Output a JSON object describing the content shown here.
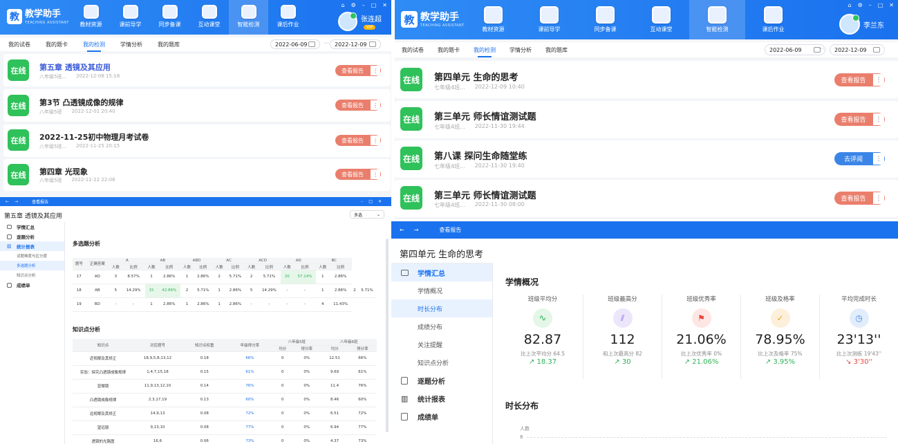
{
  "app": {
    "logo_char": "教",
    "title": "教学助手",
    "subtitle": "TEACHING ASSISTANT"
  },
  "nav": [
    {
      "label": "教材资源"
    },
    {
      "label": "课前导学"
    },
    {
      "label": "同步备课"
    },
    {
      "label": "互动课堂"
    },
    {
      "label": "智能检测"
    },
    {
      "label": "课后作业"
    }
  ],
  "tabs": [
    "我的试卷",
    "我的题卡",
    "我的检测",
    "学情分析",
    "我的题库"
  ],
  "p1": {
    "user": "张连超",
    "vip": "VIP",
    " start_date": "2022-06-09",
    "start": "2022-06-09",
    "end": "2022-12-09",
    "sep": "···",
    "cards": [
      {
        "badge": "在线",
        "title": "第五章 透镜及其应用",
        "cls": "八年级5班...",
        "date": "2022-12-08 15:18",
        "btn": "查看报告"
      },
      {
        "badge": "在线",
        "title": "第3节 凸透镜成像的规律",
        "cls": "八年级5班",
        "date": "2022-12-01 20:40",
        "btn": "查看报告"
      },
      {
        "badge": "在线",
        "title": "2022-11-25初中物理月考试卷",
        "cls": "八年级5班...",
        "date": "2022-11-25 20:15",
        "btn": "查看报告"
      },
      {
        "badge": "在线",
        "title": "第四章 光现象",
        "cls": "八年级5班",
        "date": "2022-11-22 22:08",
        "btn": "查看报告"
      }
    ]
  },
  "p2": {
    "user": "李兰东",
    "start": "2022-06-09",
    "end": "2022-12-09",
    "sep": "···",
    "cards": [
      {
        "badge": "在线",
        "title": "第四单元 生命的思考",
        "cls": "七年级4班...",
        "date": "2022-12-09 10:40",
        "btn": "查看报告"
      },
      {
        "badge": "在线",
        "title": "第三单元 师长情谊测试题",
        "cls": "七年级4班...",
        "date": "2022-11-30 19:44",
        "btn": "查看报告"
      },
      {
        "badge": "在线",
        "title": "第八课 探问生命随堂练",
        "cls": "七年级4班...",
        "date": "2022-11-30 19:40",
        "btn": "去评阅"
      },
      {
        "badge": "在线",
        "title": "第三单元 师长情谊测试题",
        "cls": "七年级4班...",
        "date": "2022-11-30 08:00",
        "btn": "查看报告"
      }
    ]
  },
  "p3": {
    "wtitle": "查看报告",
    "title": "第五章 透镜及其应用",
    "select": "多选",
    "side": [
      {
        "label": "学情汇总",
        "bold": true
      },
      {
        "label": "逐题分析",
        "bold": true
      },
      {
        "label": "统计报表",
        "bold": true,
        "act": true
      },
      {
        "label": "试题难度与区分度"
      },
      {
        "label": "多选题分析",
        "act2": true
      },
      {
        "label": "知识点分析"
      },
      {
        "label": "成绩单",
        "bold": true
      }
    ],
    "sec1": "多选题分析",
    "sec2": "知识点分析",
    "mc_groups": [
      "A",
      "AB",
      "ABD",
      "AC",
      "ACD",
      "AD",
      "BC"
    ],
    "mc_sub": [
      "人数",
      "比例"
    ],
    "mc_head": [
      "题号",
      "正确答案"
    ],
    "mc_rows": [
      [
        "17",
        "AD",
        "3",
        "8.57%",
        "1",
        "2.86%",
        "1",
        "2.86%",
        "2",
        "5.71%",
        "2",
        "5.71%",
        "20",
        "57.14%",
        "1",
        "2.86%"
      ],
      [
        "18",
        "AB",
        "5",
        "14.29%",
        "15",
        "42.86%",
        "2",
        "5.71%",
        "1",
        "2.86%",
        "5",
        "14.29%",
        "-",
        "-",
        "1",
        "2.86%",
        "2",
        "5.71%"
      ],
      [
        "19",
        "BD",
        "-",
        "-",
        "1",
        "2.86%",
        "1",
        "2.86%",
        "1",
        "2.86%",
        "-",
        "-",
        "-",
        "-",
        "4",
        "11.43%"
      ]
    ],
    "kp_head": [
      "知识点",
      "对应题号",
      "知识点权重",
      "年级得分率",
      "八年级5班",
      "八年级6班"
    ],
    "kp_sub": [
      "均分",
      "得分率",
      "均分",
      "得分率"
    ],
    "kp_rows": [
      [
        "近视眼及其矫正",
        "18,9,5,8,13,12",
        "0.18",
        "66%",
        "0",
        "0%",
        "12.51",
        "66%"
      ],
      [
        "实验：探究凸透镜成像规律",
        "1,4,7,15,18",
        "0.15",
        "61%",
        "0",
        "0%",
        "9.69",
        "61%"
      ],
      [
        "显微镜",
        "11,9,13,12,10",
        "0.14",
        "76%",
        "0",
        "0%",
        "11.4",
        "76%"
      ],
      [
        "凸透镜成像规律",
        "2,3,17,19",
        "0.13",
        "60%",
        "0",
        "0%",
        "8.46",
        "60%"
      ],
      [
        "远视眼及其矫正",
        "14,9,13",
        "0.08",
        "72%",
        "0",
        "0%",
        "6.51",
        "72%"
      ],
      [
        "望远镜",
        "9,13,10",
        "0.08",
        "77%",
        "0",
        "0%",
        "6.94",
        "77%"
      ],
      [
        "透镜的光路图",
        "16,6",
        "0.06",
        "73%",
        "0",
        "0%",
        "4.37",
        "73%"
      ]
    ]
  },
  "p4": {
    "wtitle": "查看报告",
    "title": "第四单元 生命的思考",
    "side": [
      {
        "label": "学情汇总",
        "bold": true,
        "icon": "monitor-icon"
      },
      {
        "label": "学情概况"
      },
      {
        "label": "时长分布",
        "act": true
      },
      {
        "label": "成绩分布"
      },
      {
        "label": "关注提醒"
      },
      {
        "label": "知识点分析"
      },
      {
        "label": "逐题分析",
        "bold": true,
        "icon": "doc-icon"
      },
      {
        "label": "统计报表",
        "bold": true,
        "icon": "bar-icon"
      },
      {
        "label": "成绩单",
        "bold": true,
        "icon": "list-icon"
      }
    ],
    "sec1": "学情概况",
    "sec2": "时长分布",
    "ylabel": "人数",
    "y8": "8",
    "stats": [
      {
        "label": "班级平均分",
        "value": "82.87",
        "cmp": "比上次平均分 64.5",
        "delta": "↗ 18.37",
        "color": "#2fb155",
        "bg": "#e3f6e8"
      },
      {
        "label": "班级最高分",
        "value": "112",
        "cmp": "和上次最高分 82",
        "delta": "↗ 30",
        "color": "#7a5de0",
        "bg": "#ece6fb"
      },
      {
        "label": "班级优秀率",
        "value": "21.06%",
        "cmp": "比上次优秀率 0%",
        "delta": "↗ 21.06%",
        "color": "#e5483d",
        "bg": "#fde6e4"
      },
      {
        "label": "班级及格率",
        "value": "78.95%",
        "cmp": "比上次及格率 75%",
        "delta": "↗ 3.95%",
        "color": "#f0a020",
        "bg": "#fdf0db"
      },
      {
        "label": "平均完成时长",
        "value": "23'13''",
        "cmp": "比上次测练 19'43''",
        "delta": "↘ 3'30''",
        "color": "#3b85e6",
        "bg": "#e2edfb",
        "neg": true
      }
    ]
  },
  "colors": {
    "accent": "#1a72ee",
    "online": "#2fc15a",
    "report": "#ea7e6c",
    "review": "#3b85e6",
    "up": "#2fb155",
    "down": "#e5483d"
  }
}
